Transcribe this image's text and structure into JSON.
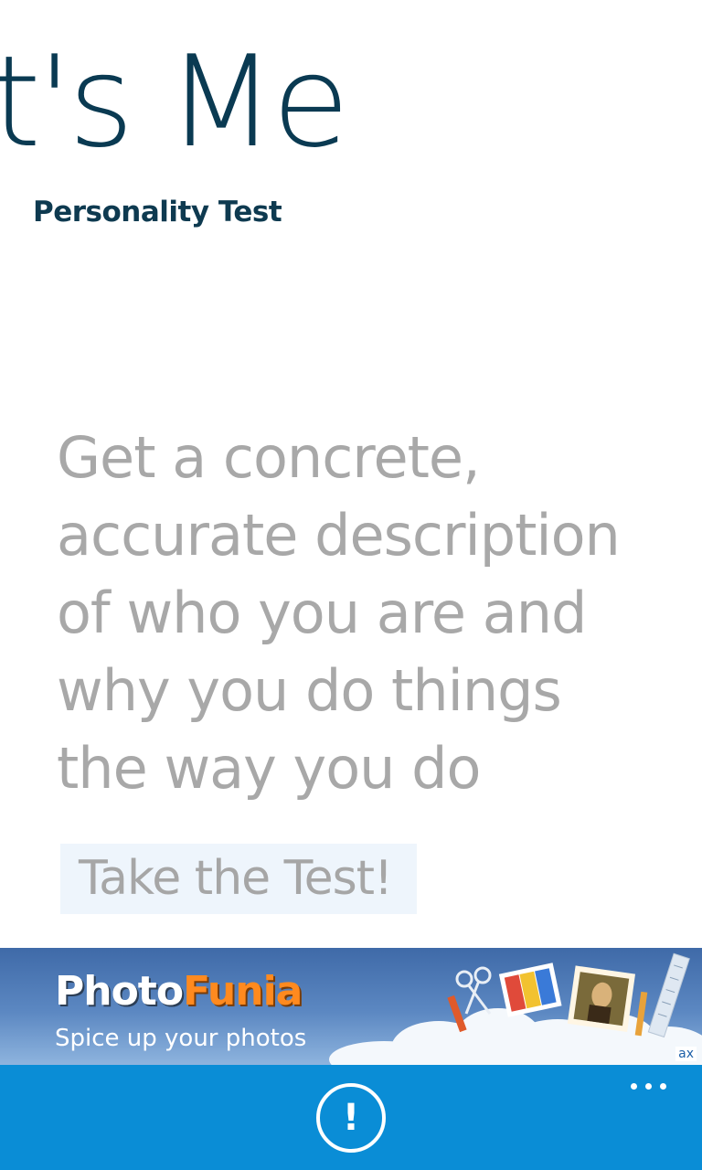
{
  "header": {
    "app_title": "It's Me",
    "subtitle": "Personality Test"
  },
  "main": {
    "description_lines": [
      "Get a concrete,",
      "accurate description",
      "of who you are and",
      "why you do things",
      "the way you do"
    ],
    "test_button_label": "Take the Test!"
  },
  "ad": {
    "brand_part1": "Photo",
    "brand_part2": "Funia",
    "tagline": "Spice up your photos",
    "badge": "ax",
    "colors": {
      "brand_part1": "#ffffff",
      "brand_part2": "#ff8a1f",
      "background_top": "#3f6aa8",
      "background_bottom": "#8eb4de"
    }
  },
  "app_bar": {
    "color": "#0a8dd6",
    "button_icon": "exclamation-circle-icon",
    "button_glyph": "!",
    "more_icon": "ellipsis-icon"
  }
}
